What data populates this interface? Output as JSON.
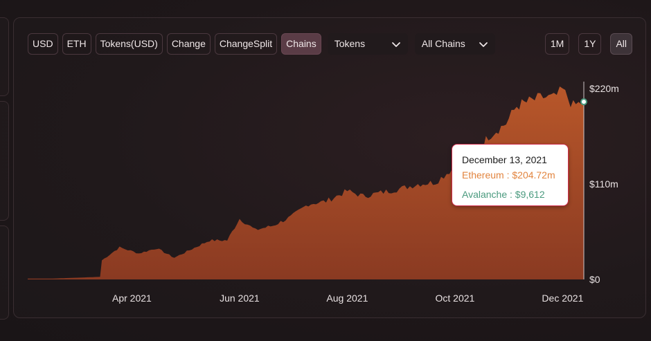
{
  "toolbar": {
    "buttons": [
      "USD",
      "ETH",
      "Tokens(USD)",
      "Change",
      "ChangeSplit",
      "Chains"
    ],
    "active": "Chains",
    "tokens_dropdown": "Tokens",
    "chains_dropdown": "All Chains"
  },
  "range_buttons": [
    "1M",
    "1Y",
    "All"
  ],
  "active_range": "All",
  "tooltip": {
    "date": "December 13, 2021",
    "ethereum": "Ethereum : $204.72m",
    "avalanche": "Avalanche : $9,612"
  },
  "colors": {
    "area_top": "#b8572a",
    "area_bottom": "#8a3a22",
    "ethereum": "#e2843e",
    "avalanche": "#4a9a7e",
    "tooltip_border": "#d02b4b"
  },
  "chart_data": {
    "type": "area",
    "series": [
      {
        "name": "Ethereum",
        "x": [
          "2021-02-01",
          "2021-02-15",
          "2021-03-01",
          "2021-03-14",
          "2021-03-15",
          "2021-03-25",
          "2021-04-05",
          "2021-04-15",
          "2021-04-25",
          "2021-05-05",
          "2021-05-15",
          "2021-05-25",
          "2021-06-01",
          "2021-06-10",
          "2021-06-20",
          "2021-06-30",
          "2021-07-10",
          "2021-07-20",
          "2021-08-01",
          "2021-08-10",
          "2021-08-20",
          "2021-09-01",
          "2021-09-10",
          "2021-09-20",
          "2021-10-01",
          "2021-10-10",
          "2021-10-20",
          "2021-10-30",
          "2021-11-05",
          "2021-11-12",
          "2021-11-20",
          "2021-11-26",
          "2021-12-01",
          "2021-12-07",
          "2021-12-13"
        ],
        "values": [
          1,
          1,
          2,
          3,
          22,
          37,
          30,
          36,
          25,
          35,
          45,
          45,
          70,
          57,
          62,
          72,
          87,
          90,
          102,
          96,
          100,
          105,
          110,
          112,
          130,
          137,
          165,
          180,
          200,
          205,
          210,
          209,
          218,
          200,
          204.72
        ]
      }
    ],
    "x_ticks": [
      "Apr 2021",
      "Jun 2021",
      "Aug 2021",
      "Oct 2021",
      "Dec 2021"
    ],
    "x_tick_dates": [
      "2021-04-01",
      "2021-06-01",
      "2021-08-01",
      "2021-10-01",
      "2021-12-01"
    ],
    "y_ticks": [
      "$0",
      "$110m",
      "$220m"
    ],
    "y_tick_values": [
      0,
      110,
      220
    ],
    "ylim": [
      0,
      220
    ],
    "xlim": [
      "2021-02-01",
      "2021-12-13"
    ],
    "ylabel": "",
    "xlabel": "",
    "title": ""
  }
}
